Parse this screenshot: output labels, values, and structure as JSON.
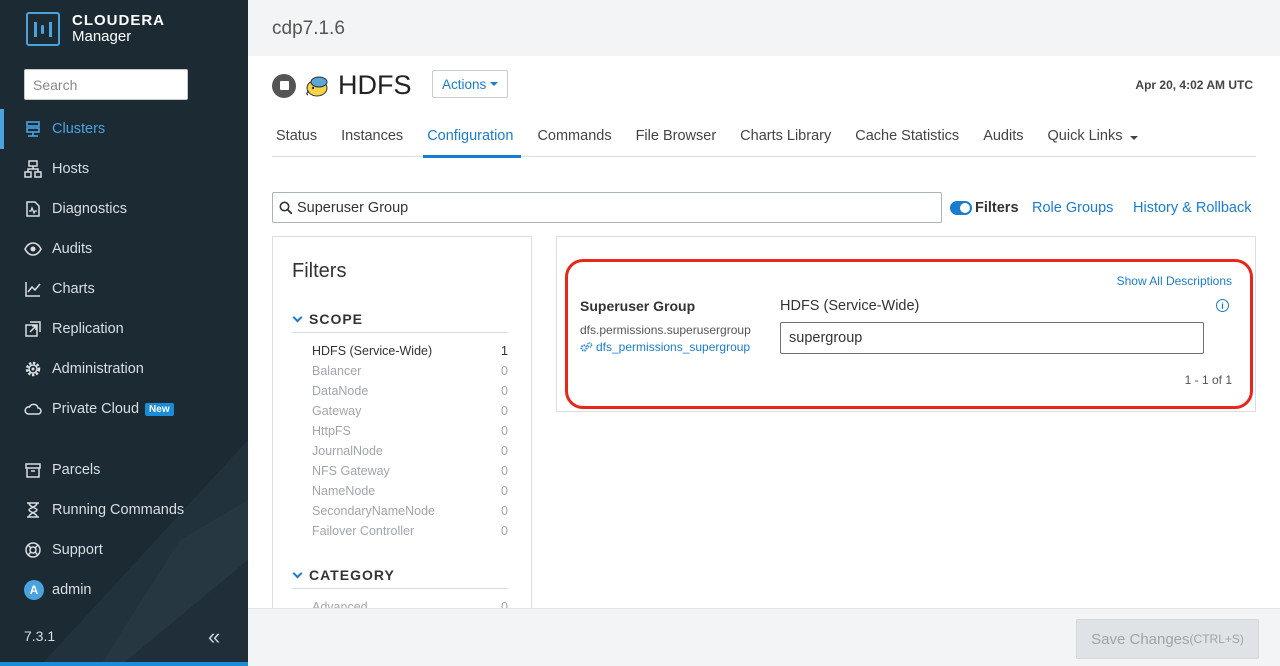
{
  "app": {
    "logo_line1": "CLOUDERA",
    "logo_line2": "Manager",
    "version": "7.3.1",
    "search_placeholder": "Search"
  },
  "sidebar": {
    "items": [
      {
        "label": "Clusters",
        "icon": "clusters-icon",
        "active": true
      },
      {
        "label": "Hosts",
        "icon": "hosts-icon"
      },
      {
        "label": "Diagnostics",
        "icon": "diagnostics-icon"
      },
      {
        "label": "Audits",
        "icon": "eye-icon"
      },
      {
        "label": "Charts",
        "icon": "chart-icon"
      },
      {
        "label": "Replication",
        "icon": "replication-icon"
      },
      {
        "label": "Administration",
        "icon": "gear-icon"
      },
      {
        "label": "Private Cloud",
        "icon": "cloud-icon",
        "badge": "New"
      },
      {
        "label": "Parcels",
        "icon": "parcel-icon"
      },
      {
        "label": "Running Commands",
        "icon": "hourglass-icon"
      },
      {
        "label": "Support",
        "icon": "support-icon"
      },
      {
        "label": "admin",
        "icon": "avatar",
        "avatar_letter": "A"
      }
    ]
  },
  "header": {
    "cluster": "cdp7.1.6",
    "service": "HDFS",
    "actions_label": "Actions",
    "timestamp": "Apr 20, 4:02 AM UTC"
  },
  "tabs": [
    {
      "label": "Status"
    },
    {
      "label": "Instances"
    },
    {
      "label": "Configuration",
      "active": true
    },
    {
      "label": "Commands"
    },
    {
      "label": "File Browser"
    },
    {
      "label": "Charts Library"
    },
    {
      "label": "Cache Statistics"
    },
    {
      "label": "Audits"
    },
    {
      "label": "Quick Links",
      "dropdown": true
    }
  ],
  "config": {
    "search_value": "Superuser Group",
    "filters_toggle_label": "Filters",
    "role_groups_label": "Role Groups",
    "history_label": "History & Rollback"
  },
  "filters": {
    "title": "Filters",
    "scope_title": "SCOPE",
    "scope": [
      {
        "label": "HDFS (Service-Wide)",
        "count": "1"
      },
      {
        "label": "Balancer",
        "count": "0"
      },
      {
        "label": "DataNode",
        "count": "0"
      },
      {
        "label": "Gateway",
        "count": "0"
      },
      {
        "label": "HttpFS",
        "count": "0"
      },
      {
        "label": "JournalNode",
        "count": "0"
      },
      {
        "label": "NFS Gateway",
        "count": "0"
      },
      {
        "label": "NameNode",
        "count": "0"
      },
      {
        "label": "SecondaryNameNode",
        "count": "0"
      },
      {
        "label": "Failover Controller",
        "count": "0"
      }
    ],
    "category_title": "CATEGORY",
    "category": [
      {
        "label": "Advanced",
        "count": "0"
      }
    ]
  },
  "result": {
    "show_all_label": "Show All Descriptions",
    "property_name": "Superuser Group",
    "property_key": "dfs.permissions.superusergroup",
    "property_link": "dfs_permissions_supergroup",
    "scope_label": "HDFS (Service-Wide)",
    "value": "supergroup",
    "pager": "1 - 1 of 1"
  },
  "footer": {
    "save_label": "Save Changes",
    "save_shortcut": "(CTRL+S)"
  },
  "colors": {
    "sidebar_bg": "#1b2a33",
    "accent": "#1a7ccf",
    "highlight": "#e8271b"
  }
}
